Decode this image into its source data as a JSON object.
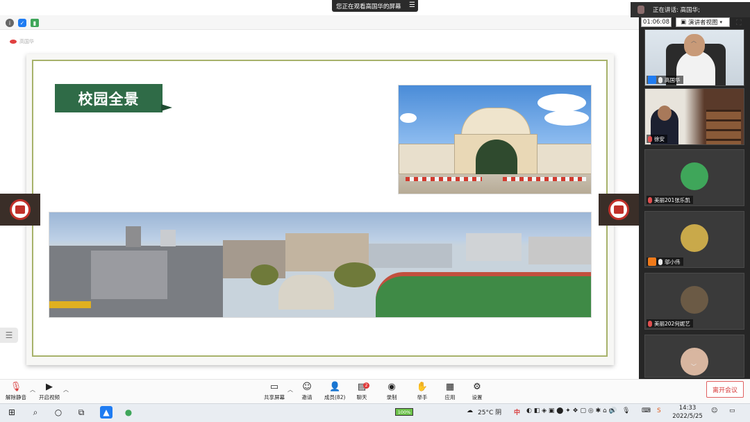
{
  "banner": {
    "text": "您正在观看高国华的屏幕",
    "menu_icon": "hamburger-icon"
  },
  "presenter_tag": {
    "text": "高国华"
  },
  "slide": {
    "title": "校园全景",
    "photos": [
      {
        "name": "campus-gate-photo",
        "subject": "school gate"
      },
      {
        "name": "campus-panorama-photo",
        "subject": "campus panorama with sports field"
      }
    ]
  },
  "meeting": {
    "speaking": "正在讲话: 高国华;",
    "timer": "01:06:08",
    "view_mode": "演讲者视图"
  },
  "participants": [
    {
      "name": "高国华",
      "type": "video",
      "mic": "on",
      "host": true
    },
    {
      "name": "徐安",
      "type": "video",
      "mic": "muted",
      "host": false
    },
    {
      "name": "美丽201张乐凯",
      "type": "avatar",
      "mic": "muted",
      "host": false,
      "avatar_color": "#3fa65a"
    },
    {
      "name": "邬小伟",
      "type": "avatar",
      "mic": "on",
      "host": false,
      "badge": "orange",
      "avatar_color": "#c9a94a"
    },
    {
      "name": "美丽202何妮艺",
      "type": "avatar",
      "mic": "muted",
      "host": false,
      "avatar_color": "#6b5a45"
    },
    {
      "name": "",
      "type": "avatar",
      "mic": "",
      "host": false,
      "avatar_color": "#d8b6a0"
    }
  ],
  "toolbar": {
    "unmute": "解除静音",
    "start_video": "开启视频",
    "share_screen": "共享屏幕",
    "invite": "邀请",
    "members": "成员(82)",
    "chat": "聊天",
    "chat_count": "2",
    "record": "录制",
    "raise_hand": "举手",
    "apps": "应用",
    "settings": "设置",
    "leave": "离开会议"
  },
  "taskbar": {
    "weather": "25°C 阴",
    "battery": "100%",
    "ime": "中",
    "time": "14:33",
    "date": "2022/5/25"
  },
  "colors": {
    "slide_border": "#a7b26b",
    "title_bg": "#2f6b47",
    "leave": "#d83a3a",
    "panel_bg": "#262626"
  }
}
